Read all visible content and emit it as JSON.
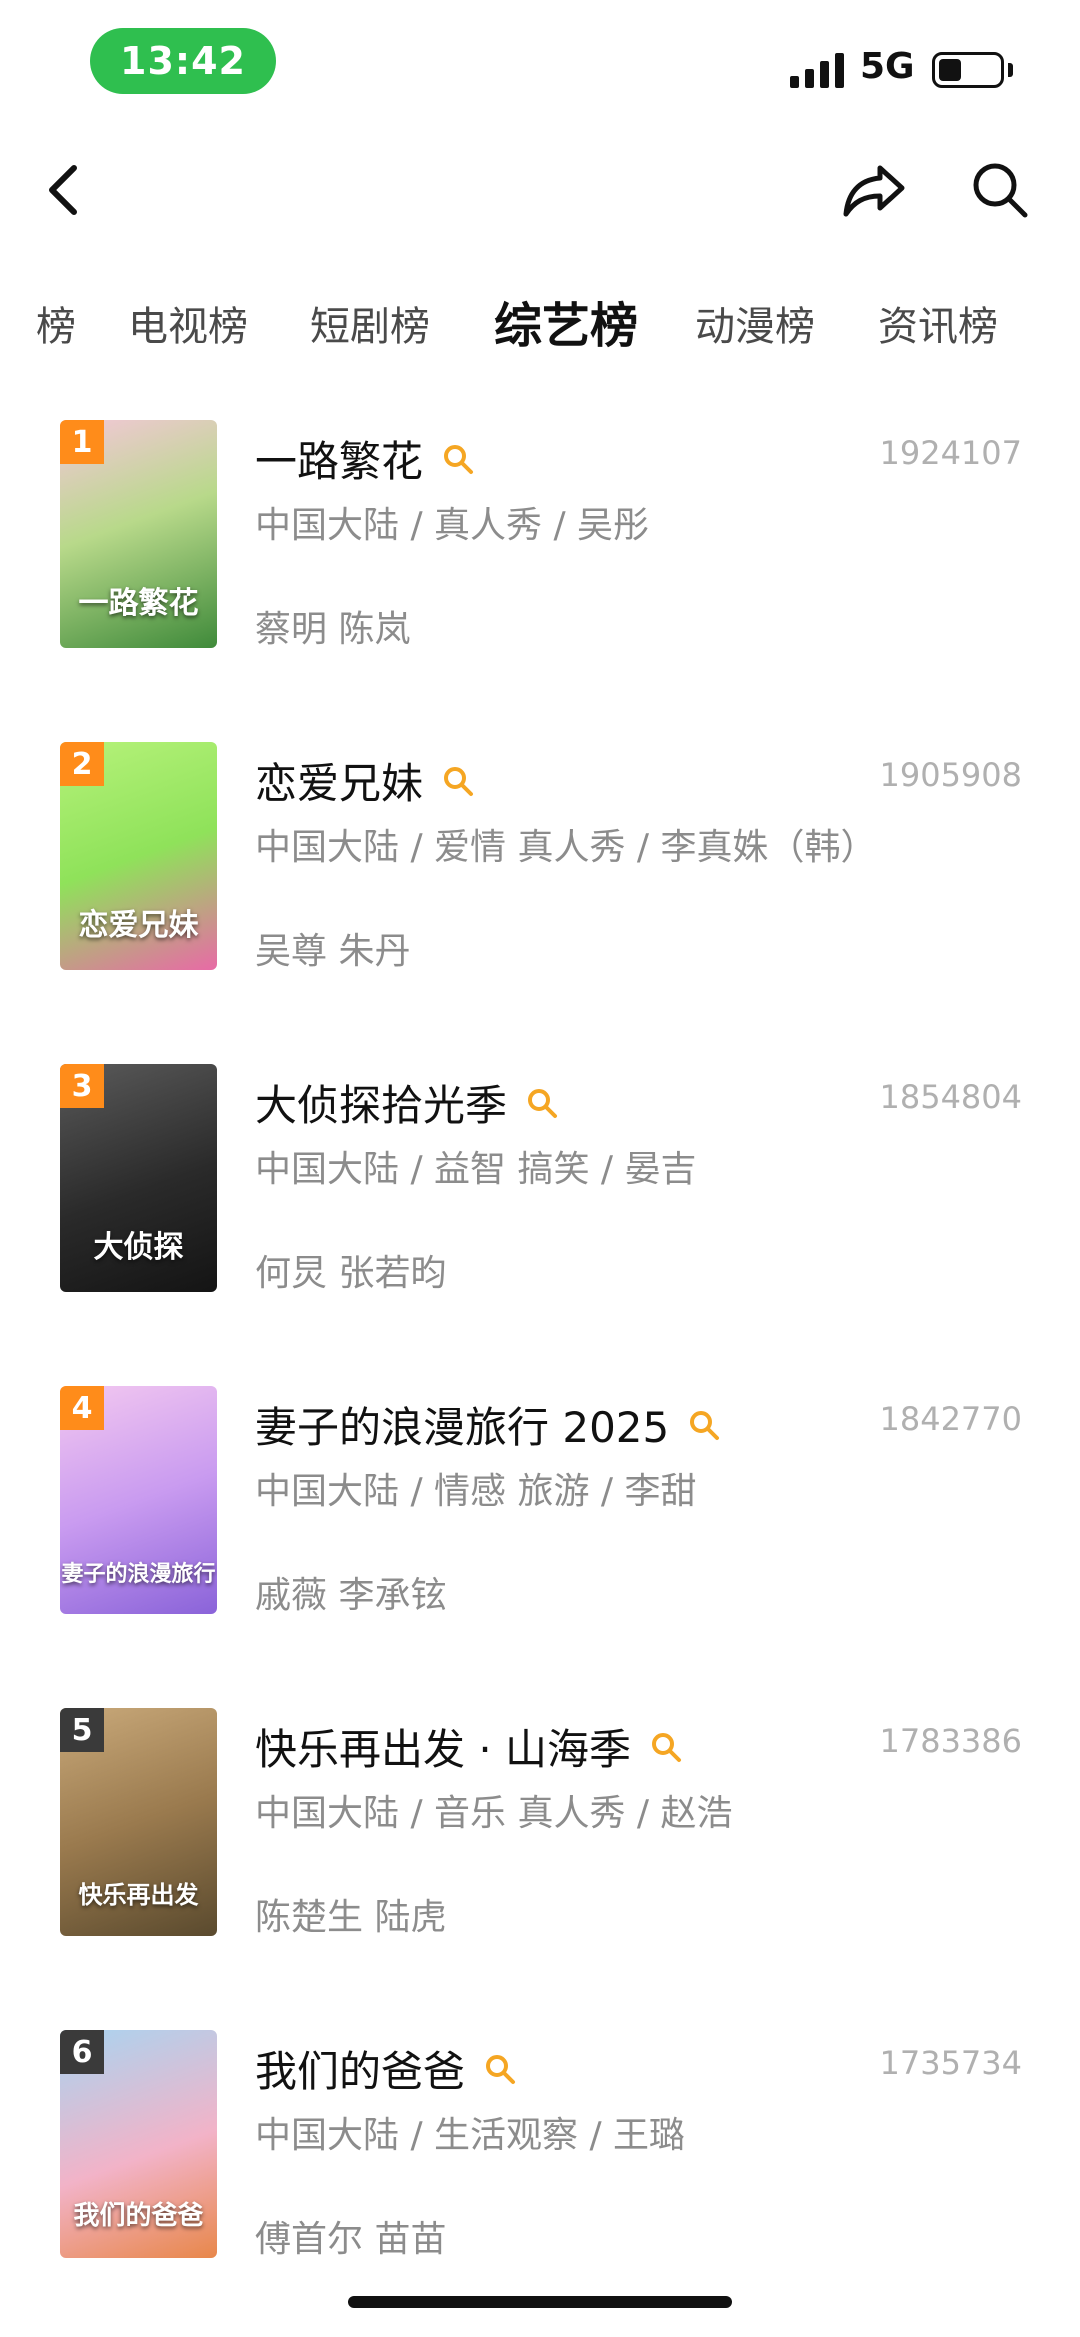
{
  "status_bar": {
    "time": "13:42",
    "network": "5G"
  },
  "tabs": [
    {
      "label": "榜"
    },
    {
      "label": "电视榜"
    },
    {
      "label": "短剧榜"
    },
    {
      "label": "综艺榜"
    },
    {
      "label": "动漫榜"
    },
    {
      "label": "资讯榜"
    }
  ],
  "items": [
    {
      "rank": "1",
      "title": "一路繁花",
      "score": "1924107",
      "meta": "中国大陆 / 真人秀 / 吴彤",
      "cast": "蔡明 陈岚",
      "poster_text": "一路繁花"
    },
    {
      "rank": "2",
      "title": "恋爱兄妹",
      "score": "1905908",
      "meta": "中国大陆 / 爱情 真人秀 / 李真姝（韩）",
      "cast": "吴尊 朱丹",
      "poster_text": "恋爱兄妹"
    },
    {
      "rank": "3",
      "title": "大侦探拾光季",
      "score": "1854804",
      "meta": "中国大陆 / 益智 搞笑 / 晏吉",
      "cast": "何炅 张若昀",
      "poster_text": "大侦探"
    },
    {
      "rank": "4",
      "title": "妻子的浪漫旅行 2025",
      "score": "1842770",
      "meta": "中国大陆 / 情感 旅游 / 李甜",
      "cast": "戚薇 李承铉",
      "poster_text": "妻子的浪漫旅行"
    },
    {
      "rank": "5",
      "title": "快乐再出发 · 山海季",
      "score": "1783386",
      "meta": "中国大陆 / 音乐 真人秀 / 赵浩",
      "cast": "陈楚生 陆虎",
      "poster_text": "快乐再出发"
    },
    {
      "rank": "6",
      "title": "我们的爸爸",
      "score": "1735734",
      "meta": "中国大陆 / 生活观察 / 王璐",
      "cast": "傅首尔 苗苗",
      "poster_text": "我们的爸爸"
    }
  ],
  "colors": {
    "accent": "#ff8c1a",
    "status_green": "#2fbf4f",
    "muted_text": "#8c8c8c",
    "score_text": "#b0b0b0"
  }
}
